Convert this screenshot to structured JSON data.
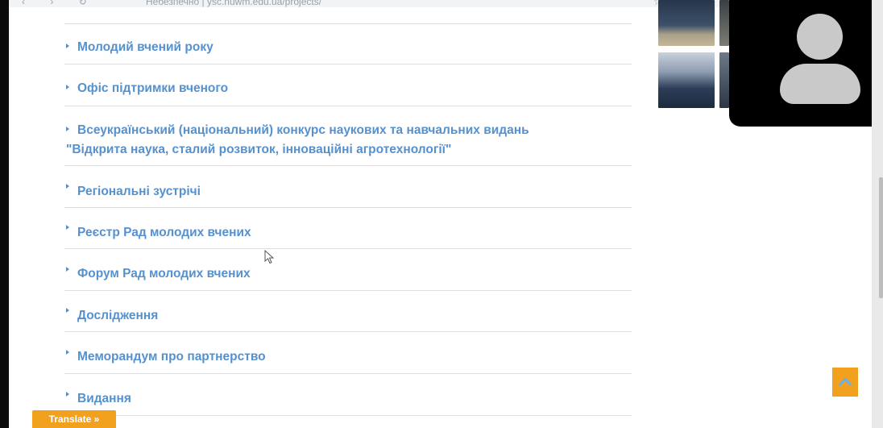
{
  "browser": {
    "nav_glyphs": "‹ › ↻",
    "url_text": "Небезпечно | ysc.nuwm.edu.ua/projects/",
    "toolbar_glyphs": "☆ ⚙"
  },
  "menu": {
    "items": [
      {
        "label": "Молодий вчений року"
      },
      {
        "label": "Офіс підтримки вченого"
      },
      {
        "label": "Всеукраїнський (національний) конкурс наукових та навчальних видань",
        "label_line2": "\"Відкрита наука, сталий розвиток, інноваційні агротехнології\""
      },
      {
        "label": "Регіональні зустрічі"
      },
      {
        "label": "Реєстр Рад молодих вчених"
      },
      {
        "label": "Форум Рад молодих вчених"
      },
      {
        "label": "Дослідження"
      },
      {
        "label": "Меморандум про партнерство"
      },
      {
        "label": "Видання"
      }
    ]
  },
  "translate": {
    "label": "Translate »"
  },
  "icons": {
    "arrow": "caret-right-icon",
    "back_to_top": "chevron-up-icon",
    "avatar": "user-avatar-icon"
  },
  "colors": {
    "link": "#5691cf",
    "accent": "#f2a11f",
    "divider": "#dedede"
  }
}
